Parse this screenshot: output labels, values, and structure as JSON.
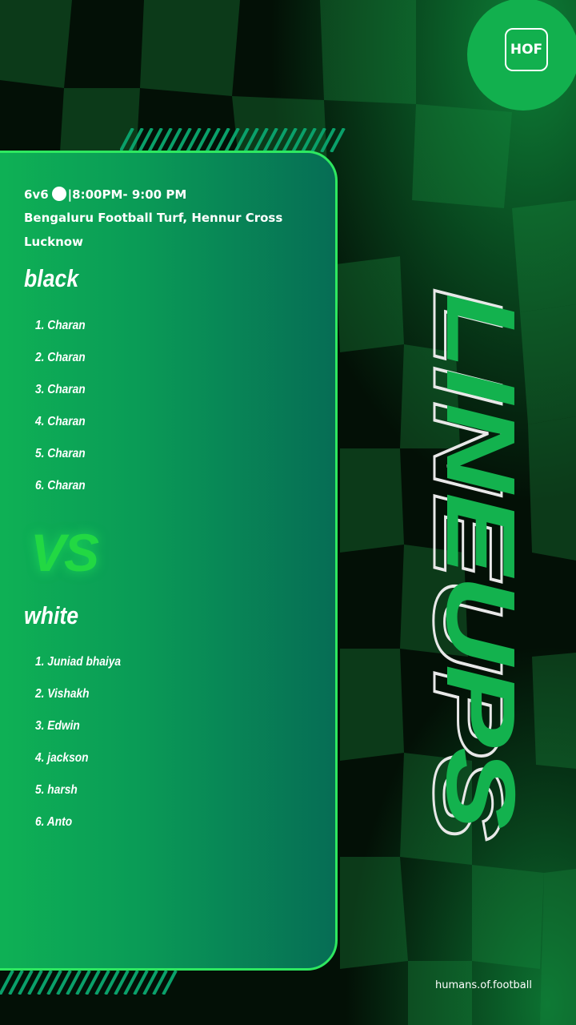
{
  "brand": {
    "logo_text": "HOF",
    "credit": "humans.of.football",
    "accent": "#12b04e"
  },
  "match": {
    "format": "6v6",
    "time": "|8:00PM- 9:00 PM",
    "venue": "Bengaluru Football Turf, Hennur Cross",
    "city": "Lucknow"
  },
  "teams": {
    "black": {
      "name": "black",
      "players": [
        "1. Charan",
        "2. Charan",
        "3. Charan",
        "4. Charan",
        "5. Charan",
        "6. Charan"
      ]
    },
    "white": {
      "name": "white",
      "players": [
        "1. Juniad bhaiya",
        "2. Vishakh",
        "3. Edwin",
        "4. jackson",
        "5. harsh",
        "6. Anto"
      ]
    }
  },
  "vs_text": "VS",
  "headline": "LINEUPS"
}
